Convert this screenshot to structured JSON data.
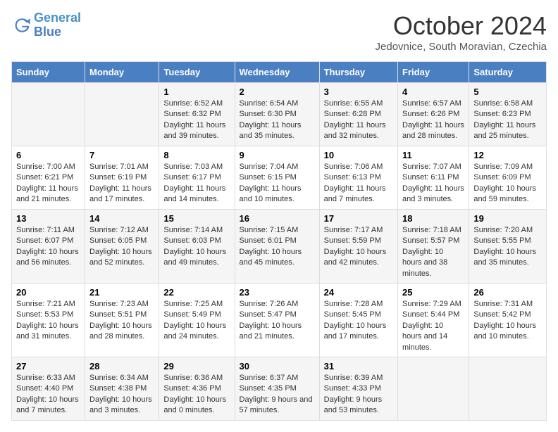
{
  "logo": {
    "line1": "General",
    "line2": "Blue"
  },
  "title": "October 2024",
  "subtitle": "Jedovnice, South Moravian, Czechia",
  "days_of_week": [
    "Sunday",
    "Monday",
    "Tuesday",
    "Wednesday",
    "Thursday",
    "Friday",
    "Saturday"
  ],
  "weeks": [
    [
      {
        "day": "",
        "info": ""
      },
      {
        "day": "",
        "info": ""
      },
      {
        "day": "1",
        "info": "Sunrise: 6:52 AM\nSunset: 6:32 PM\nDaylight: 11 hours and 39 minutes."
      },
      {
        "day": "2",
        "info": "Sunrise: 6:54 AM\nSunset: 6:30 PM\nDaylight: 11 hours and 35 minutes."
      },
      {
        "day": "3",
        "info": "Sunrise: 6:55 AM\nSunset: 6:28 PM\nDaylight: 11 hours and 32 minutes."
      },
      {
        "day": "4",
        "info": "Sunrise: 6:57 AM\nSunset: 6:26 PM\nDaylight: 11 hours and 28 minutes."
      },
      {
        "day": "5",
        "info": "Sunrise: 6:58 AM\nSunset: 6:23 PM\nDaylight: 11 hours and 25 minutes."
      }
    ],
    [
      {
        "day": "6",
        "info": "Sunrise: 7:00 AM\nSunset: 6:21 PM\nDaylight: 11 hours and 21 minutes."
      },
      {
        "day": "7",
        "info": "Sunrise: 7:01 AM\nSunset: 6:19 PM\nDaylight: 11 hours and 17 minutes."
      },
      {
        "day": "8",
        "info": "Sunrise: 7:03 AM\nSunset: 6:17 PM\nDaylight: 11 hours and 14 minutes."
      },
      {
        "day": "9",
        "info": "Sunrise: 7:04 AM\nSunset: 6:15 PM\nDaylight: 11 hours and 10 minutes."
      },
      {
        "day": "10",
        "info": "Sunrise: 7:06 AM\nSunset: 6:13 PM\nDaylight: 11 hours and 7 minutes."
      },
      {
        "day": "11",
        "info": "Sunrise: 7:07 AM\nSunset: 6:11 PM\nDaylight: 11 hours and 3 minutes."
      },
      {
        "day": "12",
        "info": "Sunrise: 7:09 AM\nSunset: 6:09 PM\nDaylight: 10 hours and 59 minutes."
      }
    ],
    [
      {
        "day": "13",
        "info": "Sunrise: 7:11 AM\nSunset: 6:07 PM\nDaylight: 10 hours and 56 minutes."
      },
      {
        "day": "14",
        "info": "Sunrise: 7:12 AM\nSunset: 6:05 PM\nDaylight: 10 hours and 52 minutes."
      },
      {
        "day": "15",
        "info": "Sunrise: 7:14 AM\nSunset: 6:03 PM\nDaylight: 10 hours and 49 minutes."
      },
      {
        "day": "16",
        "info": "Sunrise: 7:15 AM\nSunset: 6:01 PM\nDaylight: 10 hours and 45 minutes."
      },
      {
        "day": "17",
        "info": "Sunrise: 7:17 AM\nSunset: 5:59 PM\nDaylight: 10 hours and 42 minutes."
      },
      {
        "day": "18",
        "info": "Sunrise: 7:18 AM\nSunset: 5:57 PM\nDaylight: 10 hours and 38 minutes."
      },
      {
        "day": "19",
        "info": "Sunrise: 7:20 AM\nSunset: 5:55 PM\nDaylight: 10 hours and 35 minutes."
      }
    ],
    [
      {
        "day": "20",
        "info": "Sunrise: 7:21 AM\nSunset: 5:53 PM\nDaylight: 10 hours and 31 minutes."
      },
      {
        "day": "21",
        "info": "Sunrise: 7:23 AM\nSunset: 5:51 PM\nDaylight: 10 hours and 28 minutes."
      },
      {
        "day": "22",
        "info": "Sunrise: 7:25 AM\nSunset: 5:49 PM\nDaylight: 10 hours and 24 minutes."
      },
      {
        "day": "23",
        "info": "Sunrise: 7:26 AM\nSunset: 5:47 PM\nDaylight: 10 hours and 21 minutes."
      },
      {
        "day": "24",
        "info": "Sunrise: 7:28 AM\nSunset: 5:45 PM\nDaylight: 10 hours and 17 minutes."
      },
      {
        "day": "25",
        "info": "Sunrise: 7:29 AM\nSunset: 5:44 PM\nDaylight: 10 hours and 14 minutes."
      },
      {
        "day": "26",
        "info": "Sunrise: 7:31 AM\nSunset: 5:42 PM\nDaylight: 10 hours and 10 minutes."
      }
    ],
    [
      {
        "day": "27",
        "info": "Sunrise: 6:33 AM\nSunset: 4:40 PM\nDaylight: 10 hours and 7 minutes."
      },
      {
        "day": "28",
        "info": "Sunrise: 6:34 AM\nSunset: 4:38 PM\nDaylight: 10 hours and 3 minutes."
      },
      {
        "day": "29",
        "info": "Sunrise: 6:36 AM\nSunset: 4:36 PM\nDaylight: 10 hours and 0 minutes."
      },
      {
        "day": "30",
        "info": "Sunrise: 6:37 AM\nSunset: 4:35 PM\nDaylight: 9 hours and 57 minutes."
      },
      {
        "day": "31",
        "info": "Sunrise: 6:39 AM\nSunset: 4:33 PM\nDaylight: 9 hours and 53 minutes."
      },
      {
        "day": "",
        "info": ""
      },
      {
        "day": "",
        "info": ""
      }
    ]
  ]
}
